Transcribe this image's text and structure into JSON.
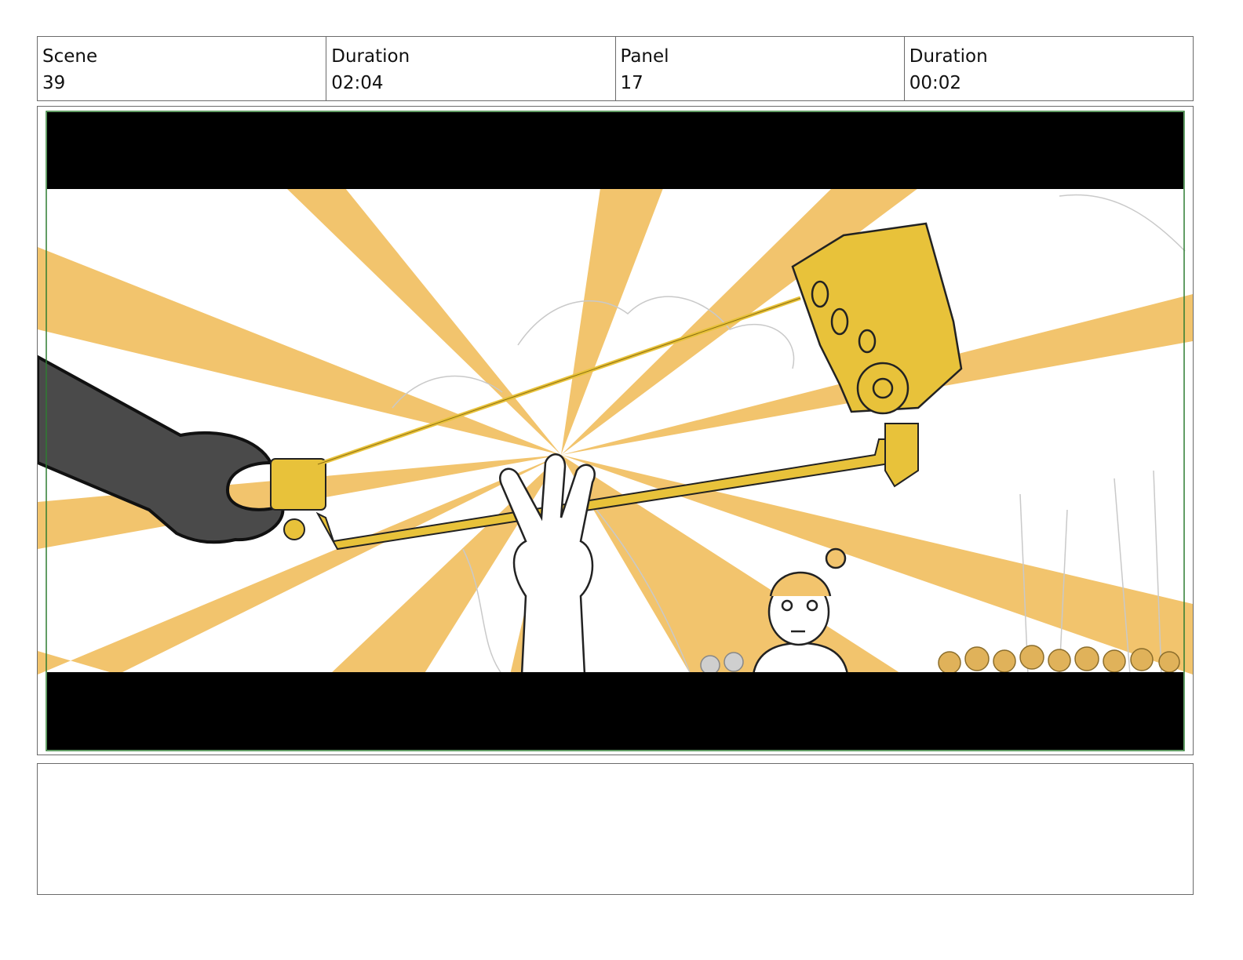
{
  "header": {
    "scene_label": "Scene",
    "scene_value": "39",
    "scene_duration_label": "Duration",
    "scene_duration_value": "02:04",
    "panel_label": "Panel",
    "panel_value": "17",
    "panel_duration_label": "Duration",
    "panel_duration_value": "00:02"
  },
  "panel_image": {
    "icon": "storyboard-drawing-icon",
    "colors": {
      "ray": "#F2C46D",
      "gold": "#E8C23A",
      "letterbox": "#000000",
      "safe_frame": "#2E7D32",
      "glove": "#4A4A4A"
    }
  },
  "notes": {
    "text": ""
  }
}
